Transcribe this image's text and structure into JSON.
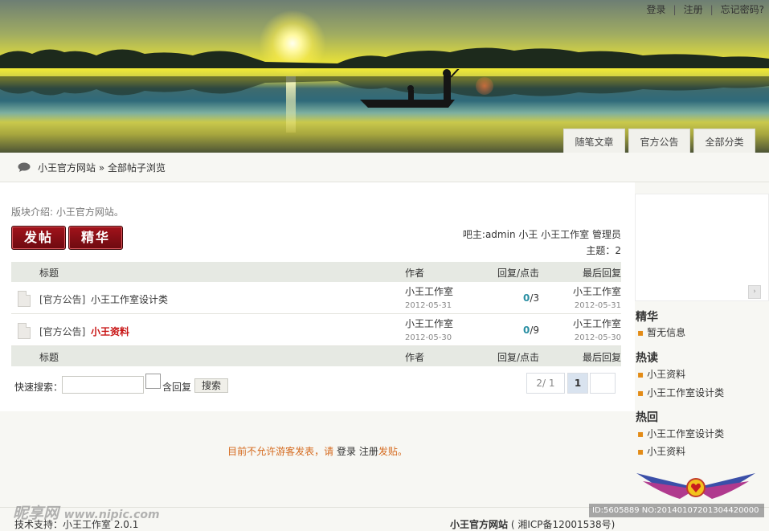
{
  "top_links": {
    "login": "登录",
    "register": "注册",
    "forgot": "忘记密码?",
    "sep": "|"
  },
  "nav": {
    "tabs": [
      "随笔文章",
      "官方公告",
      "全部分类"
    ]
  },
  "breadcrumb": {
    "home": "小王官方网站",
    "arrow": "»",
    "current": "全部帖子浏览"
  },
  "forum": {
    "intro": "版块介绍: 小王官方网站。",
    "post_button": "发帖",
    "digest_button": "精华",
    "moderators": "吧主:admin 小王 小王工作室 管理员",
    "topics_count": "主题：2"
  },
  "table": {
    "headers": {
      "title": "标题",
      "author": "作者",
      "replies": "回复/点击",
      "last": "最后回复"
    },
    "rows": [
      {
        "category": "[官方公告]",
        "title": "小王工作室设计类",
        "author": "小王工作室",
        "date": "2012-05-31",
        "replies": "0",
        "views": "/3",
        "last_author": "小王工作室",
        "last_date": "2012-05-31"
      },
      {
        "category": "[官方公告]",
        "title": "小王资料",
        "author": "小王工作室",
        "date": "2012-05-30",
        "replies": "0",
        "views": "/9",
        "last_author": "小王工作室",
        "last_date": "2012-05-30"
      }
    ]
  },
  "search": {
    "label": "快速搜索：",
    "include_replies": "含回复",
    "button": "搜索",
    "value": ""
  },
  "pagination": {
    "info": "2/ 1",
    "current": "1"
  },
  "guest_notice": {
    "prefix": "目前不允许游客发表，请",
    "login": "登录",
    "register": "注册",
    "suffix": "发贴。"
  },
  "sidebar": {
    "scroll_arrow": "›",
    "sections": [
      {
        "title": "精华",
        "items": [
          "暂无信息"
        ]
      },
      {
        "title": "热读",
        "items": [
          "小王资料",
          "小王工作室设计类"
        ]
      },
      {
        "title": "热回",
        "items": [
          "小王工作室设计类",
          "小王资料"
        ]
      }
    ]
  },
  "footer": {
    "support": "技术支持：小王工作室 2.0.1",
    "site": "小王官方网站",
    "icp": "( 湘ICP备12001538号)"
  },
  "watermark": {
    "text": "昵享网",
    "url": "www.nipic.com",
    "id": "ID:5605889 NO:20140107201304420000"
  },
  "colors": {
    "accent_red": "#8e1016",
    "reply_teal": "#2a8fa3",
    "notice_orange": "#d56a1e"
  }
}
